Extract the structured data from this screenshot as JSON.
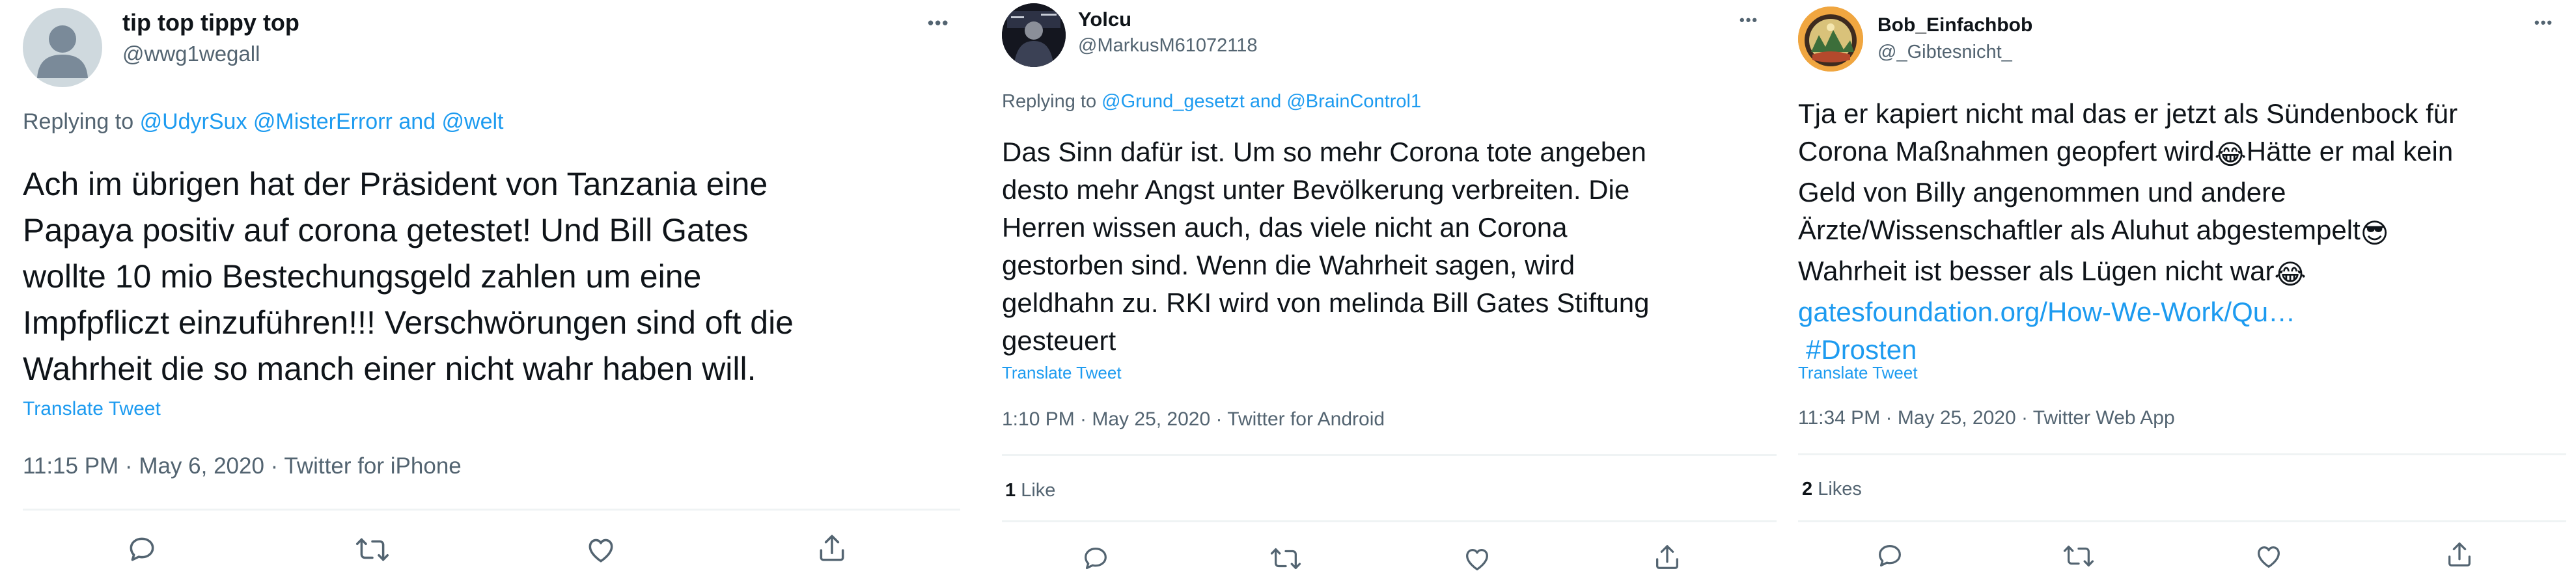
{
  "tweets": [
    {
      "name": "tip top tippy top",
      "handle": "@wwg1wegall",
      "replying_prefix": "Replying to",
      "mentions": [
        "@UdyrSux",
        "@MisterErrorr",
        "and",
        "@welt"
      ],
      "body_lines": [
        "Ach im übrigen hat der Präsident von Tanzania eine",
        "Papaya positiv auf corona getestet! Und Bill Gates",
        "wollte 10 mio Bestechungsgeld zahlen um eine",
        "Impfpfliczt einzuführen!!! Verschwörungen sind oft die",
        "Wahrheit die so manch einer nicht wahr haben will."
      ],
      "translate": "Translate Tweet",
      "meta": "11:15 PM · May 6, 2020 · Twitter for iPhone"
    },
    {
      "name": "Yolcu",
      "handle": "@MarkusM61072118",
      "replying_prefix": "Replying to",
      "mentions": [
        "@Grund_gesetzt",
        "and",
        "@BrainControl1"
      ],
      "body_lines": [
        "Das Sinn dafür ist. Um so mehr Corona tote angeben",
        "desto mehr Angst unter Bevölkerung verbreiten. Die",
        "Herren wissen auch, das viele nicht an Corona",
        "gestorben sind. Wenn die Wahrheit sagen, wird",
        "geldhahn zu. RKI wird von melinda Bill Gates Stiftung",
        "gesteuert"
      ],
      "translate": "Translate Tweet",
      "meta": "1:10 PM · May 25, 2020 · Twitter for Android",
      "likes_count": "1",
      "likes_label": "Like"
    },
    {
      "name": "Bob_Einfachbob",
      "handle": "@_Gibtesnicht_",
      "body": {
        "l1": "Tja er kapiert nicht mal das er jetzt als Sündenbock für",
        "l2": "Corona Maßnahmen geopfert wird",
        "l2b": "Hätte er mal kein",
        "l3": "Geld von Billy angenommen und andere",
        "l4": "Ärzte/Wissenschaftler als Aluhut abgestempelt",
        "l5": "Wahrheit ist besser als Lügen nicht war",
        "link": "gatesfoundation.org/How-We-Work/Qu…",
        "hashtag": "#Drosten",
        "emoji_laugh": "😂",
        "emoji_cool": "😎"
      },
      "translate": "Translate Tweet",
      "meta": "11:34 PM · May 25, 2020 · Twitter Web App",
      "likes_count": "2",
      "likes_label": "Likes"
    }
  ],
  "more_glyph": "•••",
  "icons": [
    "reply-icon",
    "retweet-icon",
    "like-icon",
    "share-icon"
  ]
}
